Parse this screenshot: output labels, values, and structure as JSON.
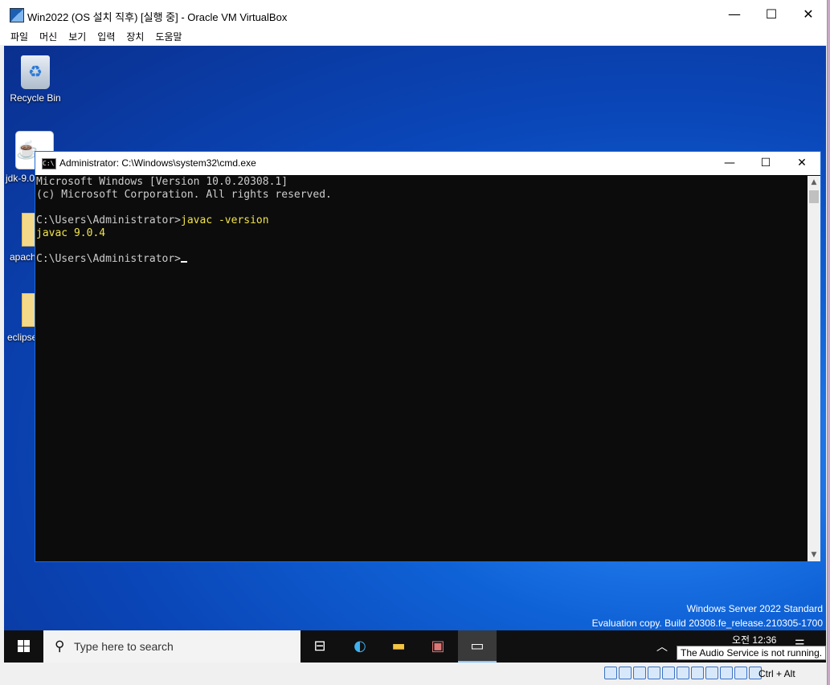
{
  "vbox": {
    "title": "Win2022 (OS 설치 직후) [실행 중] - Oracle VM VirtualBox",
    "minimize": "—",
    "maximize": "☐",
    "close": "✕",
    "menu": [
      "파일",
      "머신",
      "보기",
      "입력",
      "장치",
      "도움말"
    ],
    "host_key_label": "Ctrl + Alt"
  },
  "desktop": {
    "icons": [
      {
        "label": "Recycle Bin",
        "icon": "recycle-bin-icon"
      },
      {
        "label": "jdk-9.0",
        "icon": "java-icon"
      },
      {
        "label": "apach",
        "icon": "folder-icon"
      },
      {
        "label": "eclipse",
        "icon": "folder-icon"
      }
    ],
    "watermark_line1": "Windows Server 2022 Standard",
    "watermark_line2": "Evaluation copy. Build 20308.fe_release.210305-1700"
  },
  "cmd": {
    "title": "Administrator: C:\\Windows\\system32\\cmd.exe",
    "lines": [
      "Microsoft Windows [Version 10.0.20308.1]",
      "(c) Microsoft Corporation. All rights reserved.",
      "",
      "C:\\Users\\Administrator>",
      "javac -version",
      "javac 9.0.4",
      "",
      "C:\\Users\\Administrator>"
    ]
  },
  "taskbar": {
    "search_placeholder": "Type here to search",
    "clock_time": "오전 12:36",
    "tooltip": "The Audio Service is not running.",
    "apps": [
      "task-view-icon",
      "edge-icon",
      "file-explorer-icon",
      "app-icon",
      "cmd-icon"
    ]
  },
  "colors": {
    "console_bg": "#0c0c0c",
    "console_text": "#cccccc",
    "console_highlight": "#f0e34a",
    "taskbar_bg": "#101010"
  }
}
